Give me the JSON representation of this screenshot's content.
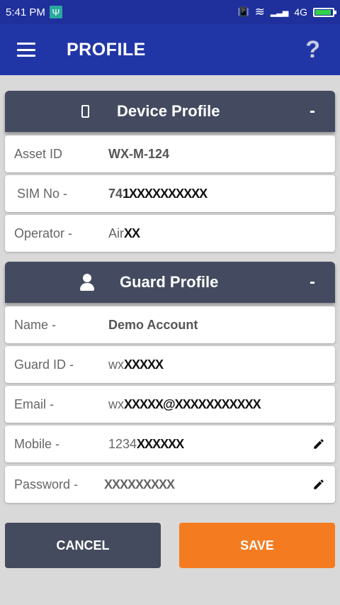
{
  "status_bar": {
    "time": "5:41 PM",
    "usb_symbol": "Ψ",
    "vibrate_symbol": "📳",
    "wifi_symbol": "≋",
    "signal_symbol": "▂▃▅",
    "network": "4G"
  },
  "app_bar": {
    "title": "PROFILE",
    "help_label": "?"
  },
  "device_profile": {
    "title": "Device Profile",
    "toggle": "-",
    "rows": [
      {
        "label": "Asset ID",
        "value": "WX-M-124"
      },
      {
        "label": "SIM No -",
        "value_visible": "74",
        "value_masked": "1XXXXXXXXXX"
      },
      {
        "label": "Operator -",
        "value_visible": "Air",
        "value_masked": "XX"
      }
    ]
  },
  "guard_profile": {
    "title": "Guard Profile",
    "toggle": "-",
    "rows": [
      {
        "label": "Name -",
        "value": "Demo Account"
      },
      {
        "label": "Guard ID -",
        "value_visible": "wx",
        "value_masked": "XXXXX"
      },
      {
        "label": "Email -",
        "value_visible": "wx",
        "value_masked": "XXXXX@XXXXXXXXXXX"
      },
      {
        "label": "Mobile -",
        "value_visible": "1234",
        "value_masked": "XXXXXX"
      },
      {
        "label": "Password -",
        "value_masked": "XXXXXXXXX"
      }
    ]
  },
  "buttons": {
    "cancel": "CANCEL",
    "save": "SAVE"
  },
  "colors": {
    "status_bar": "#1f2f9c",
    "app_bar": "#2136a6",
    "section_header": "#444b60",
    "cancel_button": "#454b5e",
    "save_button": "#f47b20"
  },
  "icons": [
    "menu-icon",
    "help-icon",
    "phone-icon",
    "user-icon",
    "pencil-icon",
    "battery-icon",
    "wifi-icon",
    "usb-icon"
  ]
}
